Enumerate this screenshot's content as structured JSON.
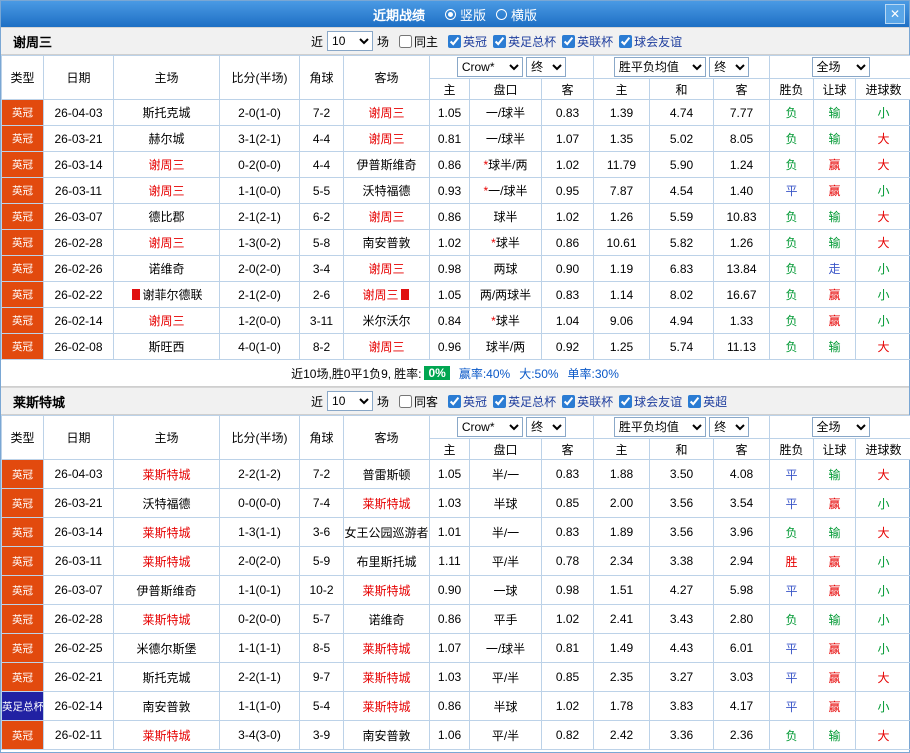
{
  "colors": {
    "accent_blue": "#1e6fc4",
    "type_england_championship": "#e24a0e",
    "type_fa_cup": "#2121a3",
    "team_highlight": "#e60000",
    "result_win_red": "#e60000",
    "result_lose_green": "#009933",
    "result_draw_blue": "#3a56c8",
    "summary_badge_green": "#00a651"
  },
  "titlebar": {
    "title": "近期战绩",
    "close_icon": "✕",
    "layout_options": [
      {
        "label": "竖版",
        "selected": true
      },
      {
        "label": "横版",
        "selected": false
      }
    ]
  },
  "filters": {
    "near_label": "近",
    "near_value": "10",
    "games_label": "场"
  },
  "columns": {
    "type": "类型",
    "date": "日期",
    "home": "主场",
    "score": "比分(半场)",
    "corner": "角球",
    "away": "客场",
    "odds_sub": [
      "主",
      "盘口",
      "客"
    ],
    "avg_sub": [
      "主",
      "和",
      "客"
    ],
    "result_sub": [
      "胜负",
      "让球",
      "进球数"
    ],
    "selects": {
      "bookmaker": "Crow*",
      "odds_final": "终",
      "avg": "胜平负均值",
      "avg_final": "终",
      "scope": "全场"
    }
  },
  "type_colors": {
    "英冠": "#e24a0e",
    "英足总杯": "#2121a3"
  },
  "sections": [
    {
      "team": "谢周三",
      "same_venue_label": "同主",
      "same_venue_checked": false,
      "competitions": [
        {
          "label": "英冠",
          "checked": true
        },
        {
          "label": "英足总杯",
          "checked": true
        },
        {
          "label": "英联杯",
          "checked": true
        },
        {
          "label": "球会友谊",
          "checked": true
        }
      ],
      "rows": [
        {
          "type": "英冠",
          "date": "26-04-03",
          "home": "斯托克城",
          "score": "2-0(1-0)",
          "corner": "7-2",
          "away": "谢周三",
          "odds": [
            "1.05",
            "一/球半",
            "0.83"
          ],
          "avg": [
            "1.39",
            "4.74",
            "7.77"
          ],
          "results": [
            "负",
            "输",
            "小"
          ]
        },
        {
          "type": "英冠",
          "date": "26-03-21",
          "home": "赫尔城",
          "score": "3-1(2-1)",
          "corner": "4-4",
          "away": "谢周三",
          "odds": [
            "0.81",
            "一/球半",
            "1.07"
          ],
          "avg": [
            "1.35",
            "5.02",
            "8.05"
          ],
          "results": [
            "负",
            "输",
            "大"
          ]
        },
        {
          "type": "英冠",
          "date": "26-03-14",
          "home": "谢周三",
          "score": "0-2(0-0)",
          "corner": "4-4",
          "away": "伊普斯维奇",
          "odds": [
            "0.86",
            "*球半/两",
            "1.02"
          ],
          "avg": [
            "11.79",
            "5.90",
            "1.24"
          ],
          "results": [
            "负",
            "赢",
            "大"
          ]
        },
        {
          "type": "英冠",
          "date": "26-03-11",
          "home": "谢周三",
          "score": "1-1(0-0)",
          "corner": "5-5",
          "away": "沃特福德",
          "odds": [
            "0.93",
            "*一/球半",
            "0.95"
          ],
          "avg": [
            "7.87",
            "4.54",
            "1.40"
          ],
          "results": [
            "平",
            "赢",
            "小"
          ]
        },
        {
          "type": "英冠",
          "date": "26-03-07",
          "home": "德比郡",
          "score": "2-1(2-1)",
          "corner": "6-2",
          "away": "谢周三",
          "odds": [
            "0.86",
            "球半",
            "1.02"
          ],
          "avg": [
            "1.26",
            "5.59",
            "10.83"
          ],
          "results": [
            "负",
            "输",
            "大"
          ]
        },
        {
          "type": "英冠",
          "date": "26-02-28",
          "home": "谢周三",
          "score": "1-3(0-2)",
          "corner": "5-8",
          "away": "南安普敦",
          "odds": [
            "1.02",
            "*球半",
            "0.86"
          ],
          "avg": [
            "10.61",
            "5.82",
            "1.26"
          ],
          "results": [
            "负",
            "输",
            "大"
          ]
        },
        {
          "type": "英冠",
          "date": "26-02-26",
          "home": "诺维奇",
          "score": "2-0(2-0)",
          "corner": "3-4",
          "away": "谢周三",
          "odds": [
            "0.98",
            "两球",
            "0.90"
          ],
          "avg": [
            "1.19",
            "6.83",
            "13.84"
          ],
          "results": [
            "负",
            "走",
            "小"
          ]
        },
        {
          "type": "英冠",
          "date": "26-02-22",
          "home": "谢菲尔德联",
          "home_badge": true,
          "score": "2-1(2-0)",
          "corner": "2-6",
          "away": "谢周三",
          "away_badge": true,
          "odds": [
            "1.05",
            "两/两球半",
            "0.83"
          ],
          "avg": [
            "1.14",
            "8.02",
            "16.67"
          ],
          "results": [
            "负",
            "赢",
            "小"
          ]
        },
        {
          "type": "英冠",
          "date": "26-02-14",
          "home": "谢周三",
          "score": "1-2(0-0)",
          "corner": "3-11",
          "away": "米尔沃尔",
          "odds": [
            "0.84",
            "*球半",
            "1.04"
          ],
          "avg": [
            "9.06",
            "4.94",
            "1.33"
          ],
          "results": [
            "负",
            "赢",
            "小"
          ]
        },
        {
          "type": "英冠",
          "date": "26-02-08",
          "home": "斯旺西",
          "score": "4-0(1-0)",
          "corner": "8-2",
          "away": "谢周三",
          "odds": [
            "0.96",
            "球半/两",
            "0.92"
          ],
          "avg": [
            "1.25",
            "5.74",
            "11.13"
          ],
          "results": [
            "负",
            "输",
            "大"
          ]
        }
      ],
      "summary": {
        "prefix": "近10场,胜0平1负9,",
        "rate_label": "胜率:",
        "rate_value": "0%",
        "win_rate": "赢率:40%",
        "big_rate": "大:50%",
        "odd_rate": "单率:30%"
      }
    },
    {
      "team": "莱斯特城",
      "same_venue_label": "同客",
      "same_venue_checked": false,
      "competitions": [
        {
          "label": "英冠",
          "checked": true
        },
        {
          "label": "英足总杯",
          "checked": true
        },
        {
          "label": "英联杯",
          "checked": true
        },
        {
          "label": "球会友谊",
          "checked": true
        },
        {
          "label": "英超",
          "checked": true
        }
      ],
      "rows": [
        {
          "type": "英冠",
          "date": "26-04-03",
          "home": "莱斯特城",
          "score": "2-2(1-2)",
          "corner": "7-2",
          "away": "普雷斯顿",
          "odds": [
            "1.05",
            "半/一",
            "0.83"
          ],
          "avg": [
            "1.88",
            "3.50",
            "4.08"
          ],
          "results": [
            "平",
            "输",
            "大"
          ]
        },
        {
          "type": "英冠",
          "date": "26-03-21",
          "home": "沃特福德",
          "score": "0-0(0-0)",
          "corner": "7-4",
          "away": "莱斯特城",
          "odds": [
            "1.03",
            "半球",
            "0.85"
          ],
          "avg": [
            "2.00",
            "3.56",
            "3.54"
          ],
          "results": [
            "平",
            "赢",
            "小"
          ]
        },
        {
          "type": "英冠",
          "date": "26-03-14",
          "home": "莱斯特城",
          "score": "1-3(1-1)",
          "corner": "3-6",
          "away": "女王公园巡游者",
          "odds": [
            "1.01",
            "半/一",
            "0.83"
          ],
          "avg": [
            "1.89",
            "3.56",
            "3.96"
          ],
          "results": [
            "负",
            "输",
            "大"
          ]
        },
        {
          "type": "英冠",
          "date": "26-03-11",
          "home": "莱斯特城",
          "score": "2-0(2-0)",
          "corner": "5-9",
          "away": "布里斯托城",
          "odds": [
            "1.11",
            "平/半",
            "0.78"
          ],
          "avg": [
            "2.34",
            "3.38",
            "2.94"
          ],
          "results": [
            "胜",
            "赢",
            "小"
          ]
        },
        {
          "type": "英冠",
          "date": "26-03-07",
          "home": "伊普斯维奇",
          "score": "1-1(0-1)",
          "corner": "10-2",
          "away": "莱斯特城",
          "odds": [
            "0.90",
            "一球",
            "0.98"
          ],
          "avg": [
            "1.51",
            "4.27",
            "5.98"
          ],
          "results": [
            "平",
            "赢",
            "小"
          ]
        },
        {
          "type": "英冠",
          "date": "26-02-28",
          "home": "莱斯特城",
          "score": "0-2(0-0)",
          "corner": "5-7",
          "away": "诺维奇",
          "odds": [
            "0.86",
            "平手",
            "1.02"
          ],
          "avg": [
            "2.41",
            "3.43",
            "2.80"
          ],
          "results": [
            "负",
            "输",
            "小"
          ]
        },
        {
          "type": "英冠",
          "date": "26-02-25",
          "home": "米德尔斯堡",
          "score": "1-1(1-1)",
          "corner": "8-5",
          "away": "莱斯特城",
          "odds": [
            "1.07",
            "一/球半",
            "0.81"
          ],
          "avg": [
            "1.49",
            "4.43",
            "6.01"
          ],
          "results": [
            "平",
            "赢",
            "小"
          ]
        },
        {
          "type": "英冠",
          "date": "26-02-21",
          "home": "斯托克城",
          "score": "2-2(1-1)",
          "corner": "9-7",
          "away": "莱斯特城",
          "odds": [
            "1.03",
            "平/半",
            "0.85"
          ],
          "avg": [
            "2.35",
            "3.27",
            "3.03"
          ],
          "results": [
            "平",
            "赢",
            "大"
          ]
        },
        {
          "type": "英足总杯",
          "date": "26-02-14",
          "home": "南安普敦",
          "score": "1-1(1-0)",
          "corner": "5-4",
          "away": "莱斯特城",
          "odds": [
            "0.86",
            "半球",
            "1.02"
          ],
          "avg": [
            "1.78",
            "3.83",
            "4.17"
          ],
          "results": [
            "平",
            "赢",
            "小"
          ]
        },
        {
          "type": "英冠",
          "date": "26-02-11",
          "home": "莱斯特城",
          "score": "3-4(3-0)",
          "corner": "3-9",
          "away": "南安普敦",
          "odds": [
            "1.06",
            "平/半",
            "0.82"
          ],
          "avg": [
            "2.42",
            "3.36",
            "2.36"
          ],
          "results": [
            "负",
            "输",
            "大"
          ]
        }
      ]
    }
  ]
}
